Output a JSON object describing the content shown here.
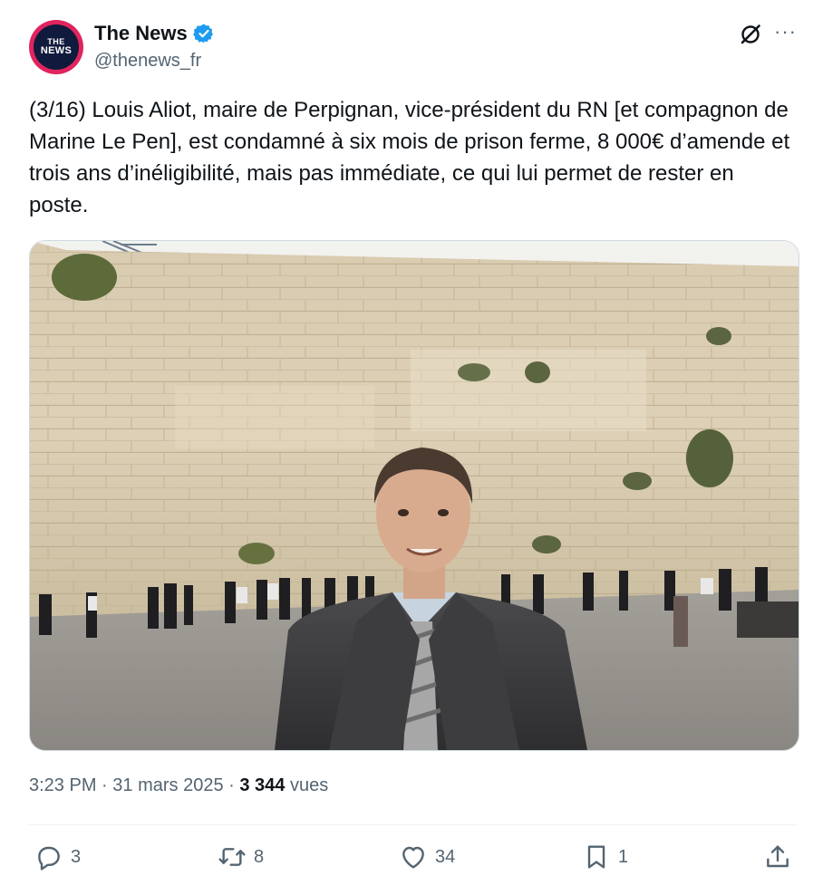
{
  "header": {
    "avatar_line1": "THE",
    "avatar_line2": "NEWS",
    "display_name": "The News",
    "handle": "@thenews_fr",
    "verified_icon": "verified-badge-icon",
    "grok_icon": "grok-icon",
    "more_icon": "more-options-icon",
    "more_glyph": "···"
  },
  "tweet": {
    "text": "(3/16) Louis Aliot, maire de Perpignan, vice-président du RN [et compagnon de Marine Le Pen], est condamné à six mois de prison ferme, 8 000€ d’amende et trois ans d’inéligibilité, mais pas immédiate, ce qui lui permet de rester en poste.",
    "time": "3:23 PM",
    "sep1": "·",
    "date": "31 mars 2025",
    "sep2": "·",
    "views_count": "3 344",
    "views_label": "vues"
  },
  "actions": {
    "replies": "3",
    "reposts": "8",
    "likes": "34",
    "bookmarks": "1"
  },
  "colors": {
    "accent": "#1d9bf0",
    "text": "#0f1419",
    "secondary": "#536471"
  }
}
